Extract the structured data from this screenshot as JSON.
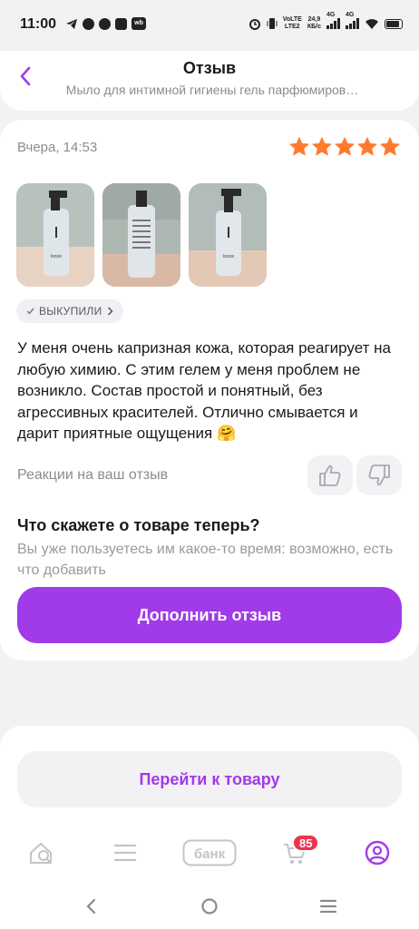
{
  "status_bar": {
    "time": "11:00",
    "net_speed": "24,9",
    "net_unit": "КБ/с",
    "volte_top": "VoLTE",
    "volte_bottom": "LTE2",
    "net_type_1": "4G",
    "net_type_2": "4G",
    "wb_label": "wb"
  },
  "header": {
    "title": "Отзыв",
    "subtitle": "Мыло для интимной гигиены гель парфюмиров…",
    "back_icon": "chevron-left-icon"
  },
  "review": {
    "date": "Вчера, 14:53",
    "rating": 5,
    "rating_max": 5,
    "star_color": "#ff7a2f",
    "photos": [
      "photo-1",
      "photo-2",
      "photo-3"
    ],
    "photo_brand": "looce",
    "badge_label": "ВЫКУПИЛИ",
    "text": "У меня очень капризная кожа, которая реагирует на любую химию. С этим гелем у меня проблем не возникло. Состав простой и понятный, без агрессивных красителей. Отлично смывается и дарит приятные ощущения 🤗",
    "reactions_label": "Реакции на ваш отзыв"
  },
  "followup": {
    "title": "Что скажете о товаре теперь?",
    "subtitle": "Вы уже пользуетесь им какое-то время: возможно, есть что добавить",
    "button_label": "Дополнить отзыв"
  },
  "product": {
    "button_label": "Перейти к товару"
  },
  "tabbar": {
    "bank_label": "банк",
    "cart_count": "85",
    "accent_color": "#a13ae8"
  }
}
